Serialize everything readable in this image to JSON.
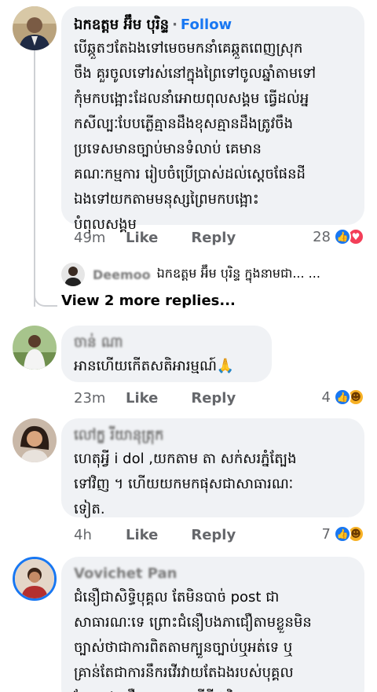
{
  "comments": [
    {
      "author": "ឯកឧត្តម អ៊ឹម បុរិន្ទ",
      "separator": "·",
      "follow_label": "Follow",
      "lines": [
        "បើឆ្កួតៗតែឯងទៅមេចមកនាំគេឆ្កួតពេញស្រុក",
        "ចឹង គួរចូលទៅរស់នៅក្នុងព្រៃទៅចូលឆ្នាំតាមទៅ",
        "កុំមកបង្អោះដែលនាំអោយពុលសង្គម ធ្វើដល់អ្ន",
        "កសីល្បៈបែបភ្លើគ្មានដឹងខុសគ្មានដឹងត្រូវចឹង",
        "ប្រទេសមានច្បាប់មានទំលាប់ គេមាន",
        "គណៈកម្មការ រៀបចំប្រើប្រាស់ដល់ស្តេចផែនដី",
        "ឯងទៅយកតាមមនុស្សព្រៃមកបង្អោះ",
        "បំពុលសង្គម"
      ],
      "time": "49m",
      "like_label": "Like",
      "reply_label": "Reply",
      "reaction_count": "28",
      "reactions": [
        "like",
        "love"
      ]
    },
    {
      "author": "ចាន់ ណា",
      "lines": [
        "អានហើយកើតសតិអារម្មណ៍🙏"
      ],
      "time": "23m",
      "like_label": "Like",
      "reply_label": "Reply",
      "reaction_count": "4",
      "reactions": [
        "like",
        "haha"
      ]
    },
    {
      "author": "លៅក្ខ រីយានុត្រុក",
      "lines": [
        "ហេតុអ្វី i dol ,យកតាម តា សក់សរភ្នំត្បែង",
        "ទៅវិញ ។ ហើយយកមកផុសជាសាធារណៈ",
        "ទៀត."
      ],
      "time": "4h",
      "like_label": "Like",
      "reply_label": "Reply",
      "reaction_count": "7",
      "reactions": [
        "like",
        "haha"
      ]
    },
    {
      "author": "Vovichet Pan",
      "lines": [
        "ជំនឿជាសិទ្ធិបុគ្គល តែមិនបាច់ post ជា",
        "សាធារណៈទេ ព្រោះជំនឿបងភាជឿតាមខ្លួនមិន",
        "ច្បាស់ថាជាការពិតតាមក្បួនច្បាប់ឬអត់ទេ ឬ",
        "គ្រាន់តែជាការនឹករវើរវាយតែឯងរបស់បុគ្គល",
        "ដែលបងជឿនោះ ... សម្ដីអ្វីជាវិធានតាម"
      ]
    }
  ],
  "reply_preview": {
    "author": "Deemoo",
    "text": "ឯកឧត្តម អ៊ឹម បុរិន្ទ ក្នុងនាមជា... ..."
  },
  "more_replies_label": "View 2 more replies..."
}
